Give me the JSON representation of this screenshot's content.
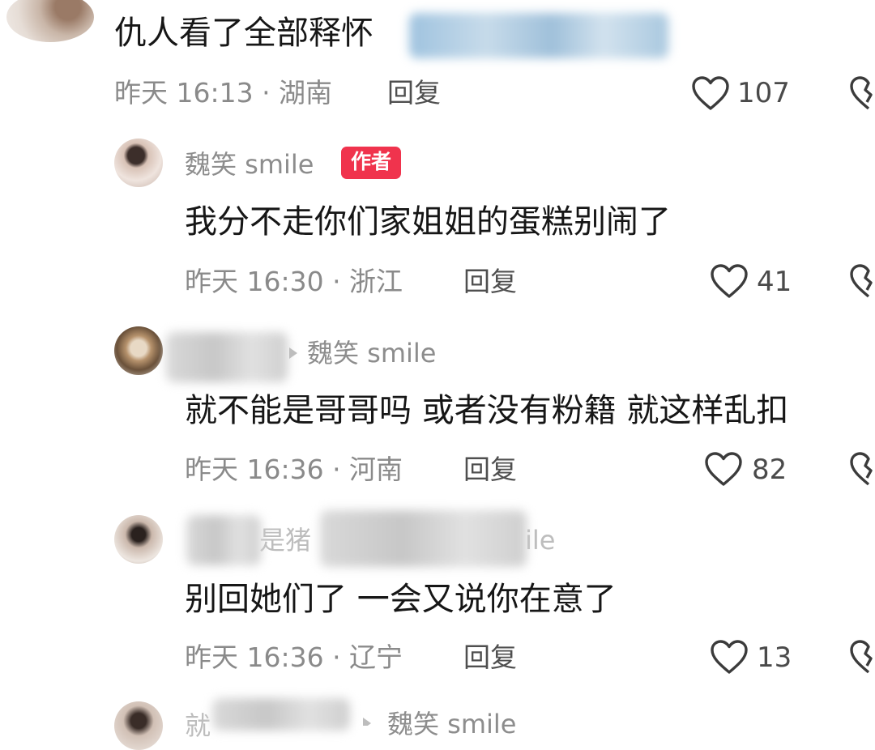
{
  "comments": [
    {
      "text": "仇人看了全部释怀",
      "meta": "昨天 16:13 · 湖南",
      "reply_label": "回复",
      "likes": "107"
    },
    {
      "username": "魏笑 smile",
      "author_badge": "作者",
      "text": "我分不走你们家姐姐的蛋糕别闹了",
      "meta": "昨天 16:30 · 浙江",
      "reply_label": "回复",
      "likes": "41"
    },
    {
      "reply_to": "魏笑 smile",
      "text": "就不能是哥哥吗 或者没有粉籍 就这样乱扣",
      "meta": "昨天 16:36 · 河南",
      "reply_label": "回复",
      "likes": "82"
    },
    {
      "username_partial_left": "是猪",
      "username_partial_right": "ile",
      "text": "别回她们了 一会又说你在意了",
      "meta": "昨天 16:36 · 辽宁",
      "reply_label": "回复",
      "likes": "13"
    },
    {
      "username_partial_left": "就",
      "reply_to_partial": "魏笑 smile"
    }
  ],
  "colors": {
    "background": "#ffffff",
    "text_primary": "#161616",
    "text_meta": "#8a8a8a",
    "author_badge": "#f0334d"
  },
  "icons": {
    "like": "heart-outline-icon",
    "dislike": "broken-heart-icon"
  }
}
